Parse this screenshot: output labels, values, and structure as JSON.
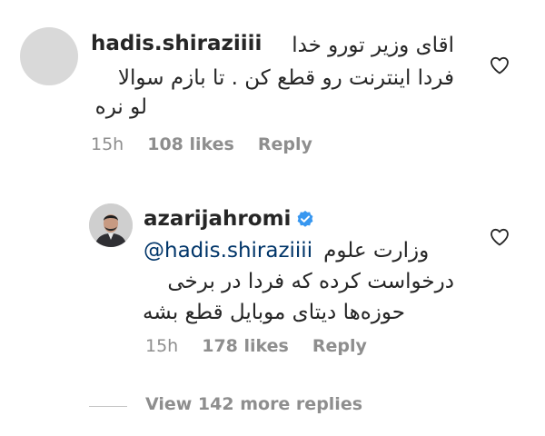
{
  "comment": {
    "username": "hadis.shiraziiii",
    "text_line1": "اقای وزیر تورو خدا",
    "text_line2": "فردا اینترنت رو قطع کن . تا بازم سوالا",
    "text_line3": "لو نره",
    "time": "15h",
    "likes": "108 likes",
    "reply_label": "Reply"
  },
  "reply": {
    "username": "azarijahromi",
    "verified": true,
    "mention": "@hadis.shiraziiii",
    "text_line1_rest": "وزارت علوم",
    "text_line2": "درخواست کرده که فردا در برخی",
    "text_line3": "حوزه‌ها دیتای موبایل قطع بشه",
    "time": "15h",
    "likes": "178 likes",
    "reply_label": "Reply"
  },
  "view_more_label": "View 142 more replies",
  "colors": {
    "text": "#262626",
    "secondary": "#8e8e8e",
    "mention": "#003569",
    "verified": "#3897f0",
    "avatar_placeholder": "#d9d9d9"
  }
}
